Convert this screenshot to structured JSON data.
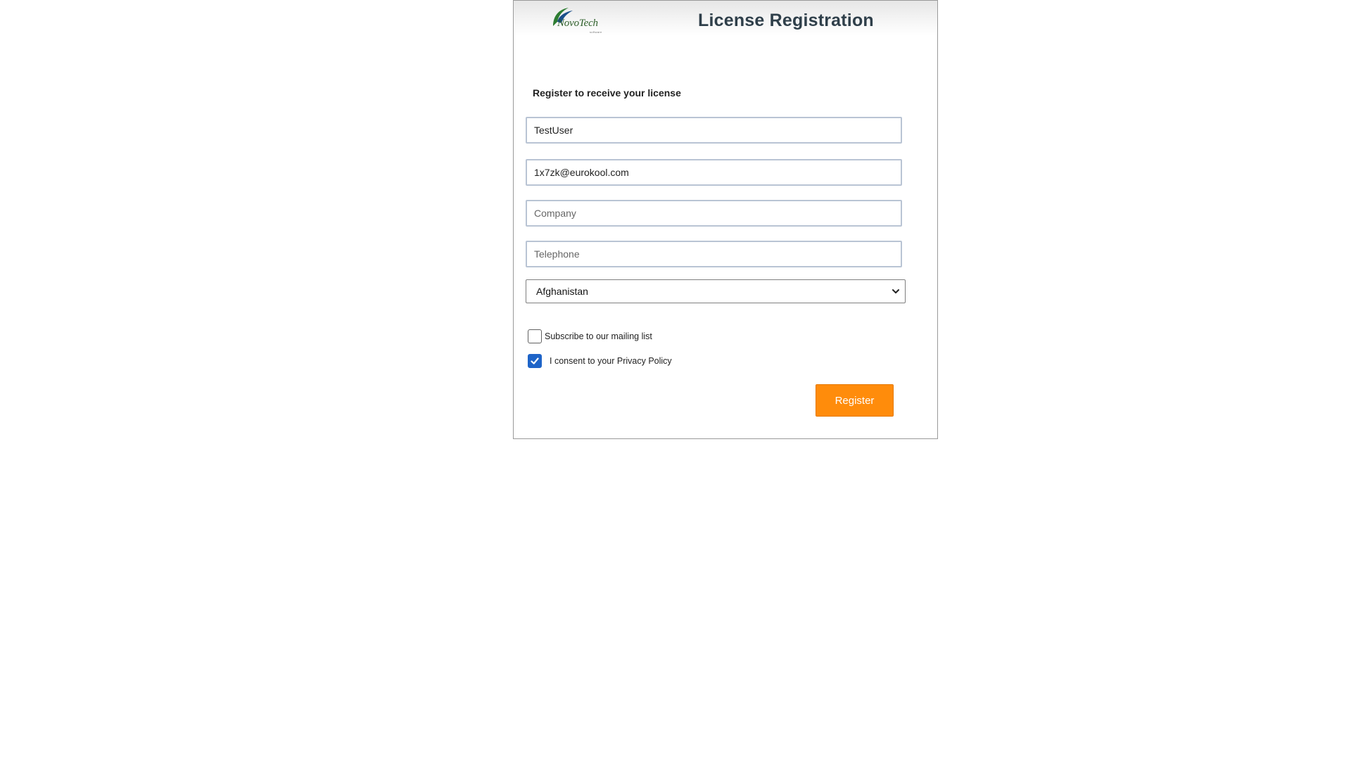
{
  "header": {
    "logo_text": "NovoTech",
    "logo_subtext": "software",
    "title": "License Registration"
  },
  "form": {
    "subtitle": "Register to receive your license",
    "name": {
      "value": "TestUser",
      "placeholder": ""
    },
    "email": {
      "value": "1x7zk@eurokool.com",
      "placeholder": ""
    },
    "company": {
      "value": "",
      "placeholder": "Company"
    },
    "telephone": {
      "value": "",
      "placeholder": "Telephone"
    },
    "country": {
      "selected": "Afghanistan"
    },
    "subscribe": {
      "label": "Subscribe to our mailing list",
      "checked": false
    },
    "consent": {
      "label": "I consent to your Privacy Policy",
      "checked": true
    },
    "register_label": "Register"
  },
  "colors": {
    "accent": "#ff8c0b",
    "checkbox": "#1e64c8",
    "title": "#2f3f4a"
  }
}
